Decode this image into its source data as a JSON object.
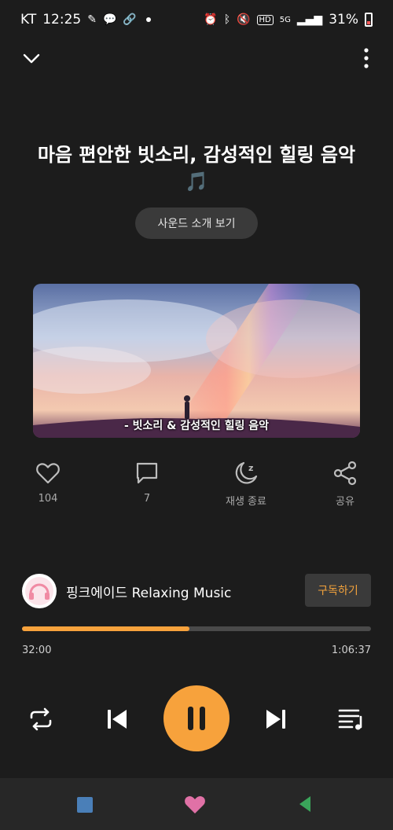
{
  "status_bar": {
    "carrier": "KT",
    "time": "12:25",
    "battery": "31%",
    "network": "5G",
    "left_icons": [
      "pen-icon",
      "talk-icon",
      "link-icon"
    ],
    "right_icons": [
      "alarm-icon",
      "bluetooth-icon",
      "mute-icon",
      "hd-icon",
      "signal-icon"
    ]
  },
  "track": {
    "title": "마음 편안한 빗소리, 감성적인 힐링 음악🎵",
    "intro_button": "사운드 소개 보기",
    "artwork_caption": "- 빗소리 & 감성적인 힐링 음악"
  },
  "actions": {
    "like_count": "104",
    "comment_count": "7",
    "sleep_label": "재생 종료",
    "share_label": "공유"
  },
  "channel": {
    "name": "핑크에이드 Relaxing Music",
    "subscribe_label": "구독하기"
  },
  "playback": {
    "elapsed": "32:00",
    "total": "1:06:37",
    "progress": 0.48
  },
  "colors": {
    "accent": "#f7a23c",
    "background": "#1c1c1c",
    "button_bg": "#3a3a3a"
  }
}
